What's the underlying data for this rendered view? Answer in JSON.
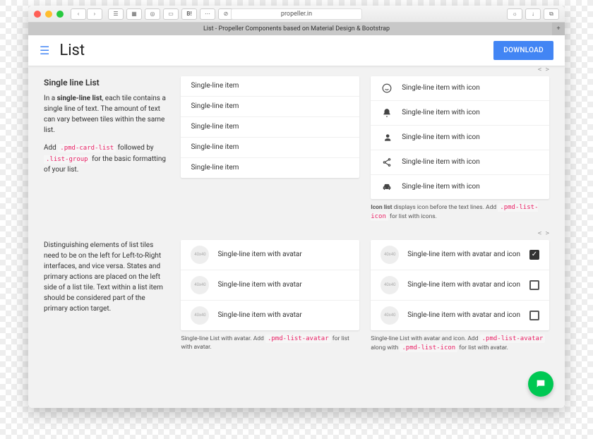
{
  "browser": {
    "address": "propeller.in",
    "tab_title": "List - Propeller Components based on Material Design & Bootstrap"
  },
  "header": {
    "title": "List",
    "download": "DOWNLOAD"
  },
  "code_toggle": "< >",
  "section1": {
    "heading": "Single line List",
    "desc_pre": "In a ",
    "desc_bold": "single-line list",
    "desc_post": ", each tile contains a single line of text. The amount of text can vary between tiles within the same list.",
    "desc2_pre": "Add ",
    "code1": ".pmd-card-list",
    "desc2_mid": " followed by ",
    "code2": ".list-group",
    "desc2_post": " for the basic formatting of your list.",
    "plain_items": [
      "Single-line item",
      "Single-line item",
      "Single-line item",
      "Single-line item",
      "Single-line item"
    ],
    "icon_items": [
      {
        "icon": "emoji",
        "label": "Single-line item with icon"
      },
      {
        "icon": "bell",
        "label": "Single-line item with icon"
      },
      {
        "icon": "person",
        "label": "Single-line item with icon"
      },
      {
        "icon": "share",
        "label": "Single-line item with icon"
      },
      {
        "icon": "car",
        "label": "Single-line item with icon"
      }
    ],
    "icon_caption_bold": "Icon list",
    "icon_caption_pre": " displays icon before the text lines. Add ",
    "icon_caption_code": ".pmd-list-icon",
    "icon_caption_post": " for list with icons."
  },
  "section2": {
    "desc": "Distinguishing elements of list tiles need to be on the left for Left-to-Right interfaces, and vice versa. States and primary actions are placed on the left side of a list tile. Text within a list item should be considered part of the primary action target.",
    "avatar_placeholder": "40x40",
    "avatar_items": [
      "Single-line item with avatar",
      "Single-line item with avatar",
      "Single-line item with avatar"
    ],
    "avatar_caption_pre": "Single-line List with avatar. Add ",
    "avatar_caption_code": ".pmd-list-avatar",
    "avatar_caption_post": " for list with avatar.",
    "avatar_icon_items": [
      {
        "label": "Single-line item with avatar and icon",
        "checked": true
      },
      {
        "label": "Single-line item with avatar and icon",
        "checked": false
      },
      {
        "label": "Single-line item with avatar and icon",
        "checked": false
      }
    ],
    "avicon_caption_pre": "Single-line List with avatar and icon. Add ",
    "avicon_caption_code1": ".pmd-list-avatar",
    "avicon_caption_mid": " along with ",
    "avicon_caption_code2": ".pmd-list-icon",
    "avicon_caption_post": " for list with avatar."
  }
}
